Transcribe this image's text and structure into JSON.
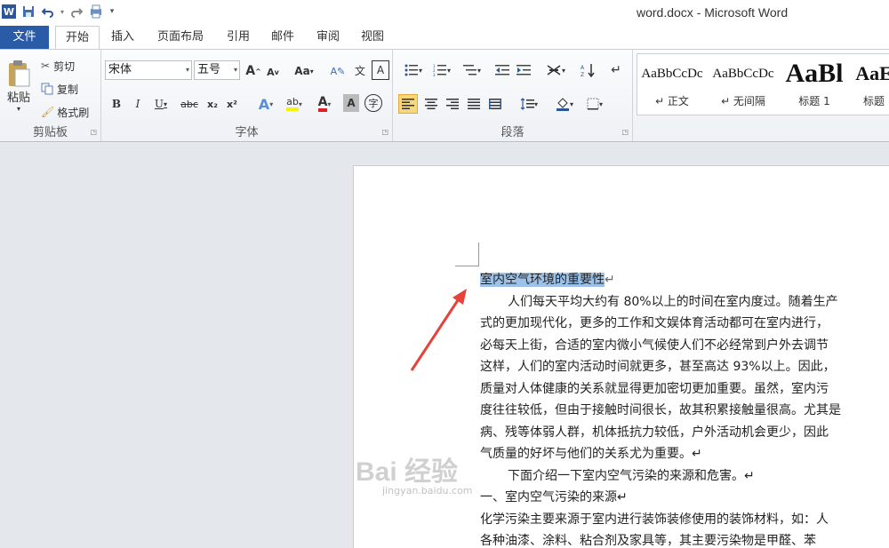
{
  "window": {
    "title": "word.docx - Microsoft Word"
  },
  "qat": {
    "word_logo": "W"
  },
  "tabs": [
    {
      "label": "文件"
    },
    {
      "label": "开始"
    },
    {
      "label": "插入"
    },
    {
      "label": "页面布局"
    },
    {
      "label": "引用"
    },
    {
      "label": "邮件"
    },
    {
      "label": "审阅"
    },
    {
      "label": "视图"
    }
  ],
  "ribbon": {
    "clipboard": {
      "group_label": "剪贴板",
      "paste": "粘贴",
      "cut": "剪切",
      "copy": "复制",
      "format_painter": "格式刷"
    },
    "font": {
      "group_label": "字体",
      "font_name": "宋体",
      "font_size": "五号",
      "bold": "B",
      "italic": "I",
      "underline": "U",
      "strikethrough": "abc",
      "change_case": "Aa",
      "grow": "A",
      "shrink": "A",
      "subscript": "x₂",
      "superscript": "x²",
      "highlight": "ab",
      "font_color": "A",
      "char_shading": "A",
      "enclose": "字",
      "phonetic": "文",
      "char_border": "A",
      "text_effects": "A"
    },
    "paragraph": {
      "group_label": "段落"
    },
    "styles": {
      "items": [
        {
          "sample": "AaBbCcDc",
          "name": "↵ 正文"
        },
        {
          "sample": "AaBbCcDc",
          "name": "↵ 无间隔"
        },
        {
          "sample": "AaBl",
          "name": "标题 1"
        },
        {
          "sample": "AaE",
          "name": "标题"
        }
      ]
    }
  },
  "document": {
    "title": "室内空气环境的重要性",
    "title_mark": "↵",
    "paragraphs": [
      "人们每天平均大约有 80%以上的时间在室内度过。随着生产",
      "式的更加现代化，更多的工作和文娱体育活动都可在室内进行，",
      "必每天上街，合适的室内微小气候使人们不必经常到户外去调节",
      "这样，人们的室内活动时间就更多，甚至高达 93%以上。因此，",
      "质量对人体健康的关系就显得更加密切更加重要。虽然，室内污",
      "度往往较低，但由于接触时间很长，故其积累接触量很高。尤其是",
      "病、残等体弱人群，机体抵抗力较低，户外活动机会更少，因此",
      "气质量的好坏与他们的关系尤为重要。↵",
      "下面介绍一下室内空气污染的来源和危害。↵",
      "一、室内空气污染的来源↵",
      "化学污染主要来源于室内进行装饰装修使用的装饰材料，如：人",
      "各种油漆、涂料、粘合剂及家具等，其主要污染物是甲醛、苯"
    ]
  },
  "watermark": {
    "text": "Bai 经验",
    "sub": "jingyan.baidu.com"
  },
  "colors": {
    "file_tab": "#2a5ba6",
    "selection": "#9cc2e9",
    "arrow": "#e8413a"
  }
}
